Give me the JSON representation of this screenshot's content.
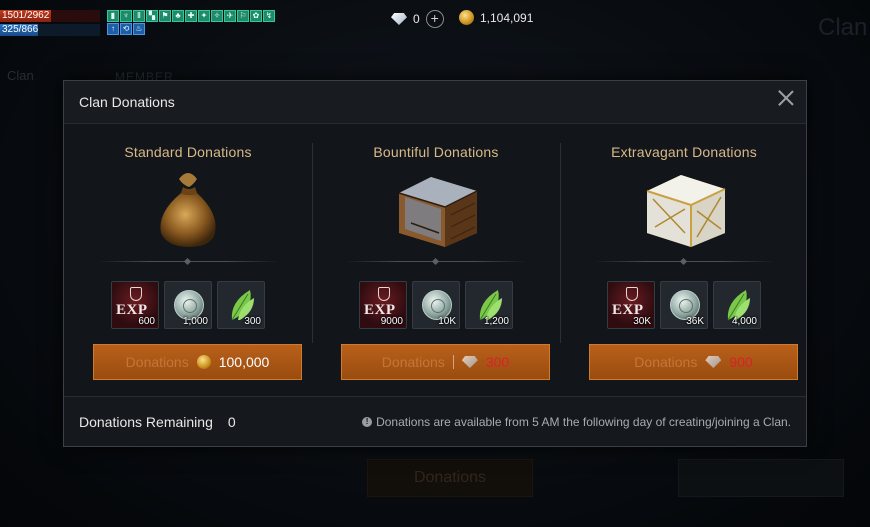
{
  "hud": {
    "hp_text": "1501/2962",
    "hp_fraction": 0.507,
    "mp_text": "325/866",
    "mp_fraction": 0.375,
    "buff_glyphs": [
      "▮",
      "♆",
      "Ⅱ",
      "▚",
      "⚑",
      "♣",
      "✚",
      "✦",
      "✧",
      "✈",
      "⚐",
      "✿",
      "↯",
      "↑",
      "⟲",
      "♨"
    ],
    "gems": "0",
    "gold": "1,104,091"
  },
  "background": {
    "title": "Clan",
    "clan_label": "Clan",
    "member_label": "MEMBER",
    "donate_button": "Donations"
  },
  "modal": {
    "title": "Clan Donations",
    "tiers": [
      {
        "name": "Standard Donations",
        "rewards": [
          "600",
          "1,000",
          "300"
        ],
        "button_label": "Donations",
        "cost": "100,000",
        "cost_currency": "gold"
      },
      {
        "name": "Bountiful Donations",
        "rewards": [
          "9000",
          "10K",
          "1,200"
        ],
        "button_label": "Donations",
        "cost": "300",
        "cost_currency": "gem"
      },
      {
        "name": "Extravagant Donations",
        "rewards": [
          "30K",
          "36K",
          "4,000"
        ],
        "button_label": "Donations",
        "cost": "900",
        "cost_currency": "gem"
      }
    ],
    "exp_label": "EXP",
    "remaining_label": "Donations Remaining",
    "remaining_value": "0",
    "notice": "Donations are available from 5 AM the following day of creating/joining a Clan."
  },
  "colors": {
    "accent": "#b8601a",
    "tier_name": "#d9b98a",
    "cost_red": "#d8232a"
  }
}
